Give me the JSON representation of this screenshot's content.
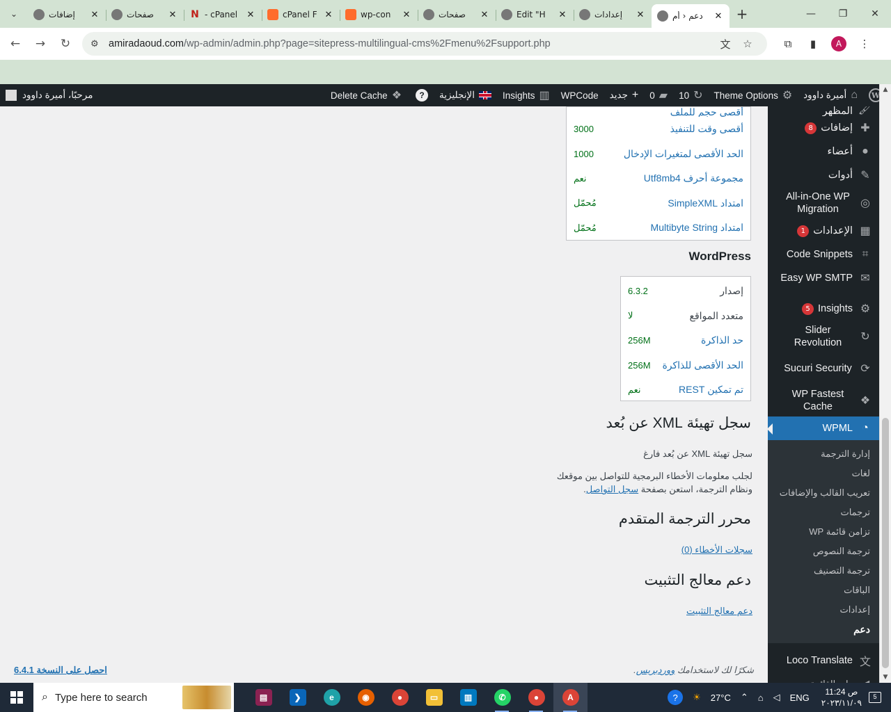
{
  "browser": {
    "tabs": [
      {
        "title": "إضافات",
        "icon": "wp-icon"
      },
      {
        "title": "صفحات",
        "icon": "wp-icon"
      },
      {
        "title": "cPanel -",
        "icon": "namecheap-icon"
      },
      {
        "title": "cPanel F",
        "icon": "cpanel-icon"
      },
      {
        "title": "wp-con",
        "icon": "cpanel-icon"
      },
      {
        "title": "صفحات",
        "icon": "wp-icon"
      },
      {
        "title": "Edit \"H",
        "icon": "globe-icon"
      },
      {
        "title": "إعدادات",
        "icon": "wp-icon"
      },
      {
        "title": "دعم ‹ أم",
        "icon": "wp-icon"
      }
    ],
    "url_host": "amiradaoud.com",
    "url_path": "/wp-admin/admin.php?page=sitepress-multilingual-cms%2Fmenu%2Fsupport.php",
    "profile_initial": "A"
  },
  "adminbar": {
    "site_name": "أميرة داوود",
    "theme_options": "Theme Options",
    "updates": "10",
    "comments": "0",
    "new_label": "جديد",
    "wpcode": "WPCode",
    "insights": "Insights",
    "language": "الإنجليزية",
    "delete_cache": "Delete Cache",
    "greeting": "مرحبًا، أميرة داوود"
  },
  "sidebar": {
    "partial_top": "المظهر",
    "items": [
      {
        "label": "إضافات",
        "badge": "8",
        "icon": "plugins-icon"
      },
      {
        "label": "أعضاء",
        "icon": "users-icon"
      },
      {
        "label": "أدوات",
        "icon": "tools-icon"
      },
      {
        "label": "All-in-One WP Migration",
        "icon": "migration-icon"
      },
      {
        "label": "الإعدادات",
        "badge": "1",
        "icon": "settings-icon"
      },
      {
        "label": "Code Snippets",
        "icon": "code-icon"
      },
      {
        "label": "Easy WP SMTP",
        "icon": "smtp-icon"
      },
      {
        "label": "Insights",
        "badge": "5",
        "icon": "insights-icon"
      },
      {
        "label": "Slider Revolution",
        "icon": "slider-icon"
      },
      {
        "label": "Sucuri Security",
        "icon": "sucuri-icon"
      },
      {
        "label": "WP Fastest Cache",
        "icon": "cheetah-icon"
      },
      {
        "label": "WPML",
        "icon": "wpml-icon"
      }
    ],
    "submenu": [
      "إدارة الترجمة",
      "لغات",
      "تعريب القالب والإضافات",
      "ترجمات",
      "تزامن قائمة WP",
      "ترجمة النصوص",
      "ترجمة التصنيف",
      "الباقات",
      "إعدادات",
      "دعم"
    ],
    "after": [
      {
        "label": "Loco Translate",
        "icon": "translate-icon"
      },
      {
        "label": "طي القائمة",
        "icon": "collapse-icon"
      }
    ]
  },
  "server_table": {
    "partial_top": "أقصى حجم للملف",
    "rows": [
      {
        "key": "أقصى وقت للتنفيذ",
        "value": "3000"
      },
      {
        "key": "الحد الأقصى لمتغيرات الإدخال",
        "value": "1000"
      },
      {
        "key": "مجموعة أحرف Utf8mb4",
        "value": "نعم"
      },
      {
        "key": "امتداد SimpleXML",
        "value": "مُحمّل"
      },
      {
        "key": "امتداد Multibyte String",
        "value": "مُحمّل"
      }
    ]
  },
  "wordpress": {
    "heading": "WordPress",
    "rows": [
      {
        "key": "إصدار",
        "value": "6.3.2",
        "dark": true
      },
      {
        "key": "متعدد المواقع",
        "value": "لا",
        "dark": true
      },
      {
        "key": "حد الذاكرة",
        "value": "256M"
      },
      {
        "key": "الحد الأقصى للذاكرة",
        "value": "256M"
      },
      {
        "key": "تم تمكين REST",
        "value": "نعم"
      }
    ]
  },
  "xml_log": {
    "heading": "سجل تهيئة XML عن بُعد",
    "empty_text": "سجل تهيئة XML عن بُعد فارغ",
    "info_line1": "لجلب معلومات الأخطاء البرمجية للتواصل بين موقعك",
    "info_line2_prefix": "ونظام الترجمة، استعن بصفحة",
    "info_link": "سجل التواصل",
    "info_suffix": "."
  },
  "ate": {
    "heading": "محرر الترجمة المتقدم",
    "link": "سجلات الأخطاء (0)"
  },
  "wizard": {
    "heading": "دعم معالج التثبيت",
    "link": "دعم معالج التثبيت"
  },
  "footer": {
    "thanks_prefix": "شكرًا لك لاستخدامك",
    "thanks_link": "ووردبريس",
    "thanks_suffix": ".",
    "version_link": "احصل على النسخة 6.4.1"
  },
  "taskbar": {
    "search_placeholder": "Type here to search",
    "temperature": "27°C",
    "language": "ENG",
    "time": "11:24 ص",
    "date": "٢٠٢٣/١١/٠٩",
    "notifications": "5"
  }
}
